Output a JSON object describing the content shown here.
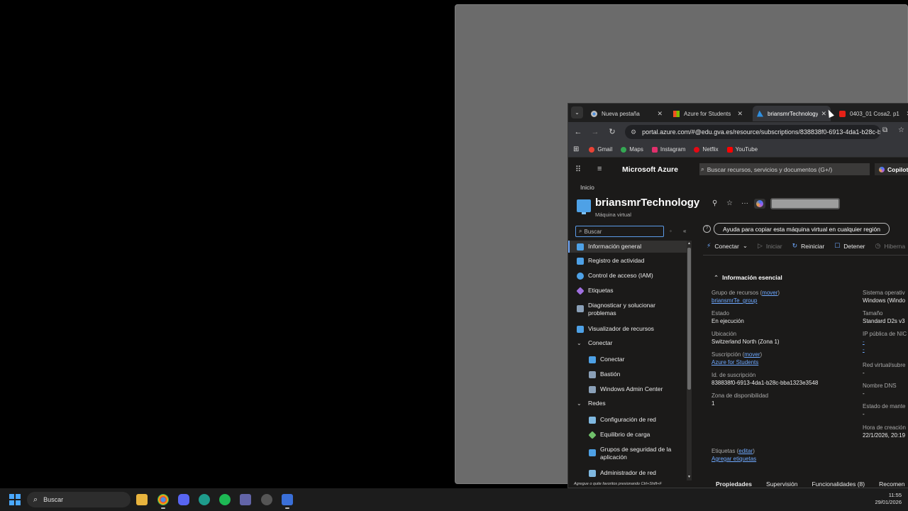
{
  "tabs": [
    {
      "title": "Nueva pestaña",
      "close": "✕",
      "icon": "chrome-icon"
    },
    {
      "title": "Azure for Students",
      "close": "✕",
      "icon": "microsoft-icon"
    },
    {
      "title": "briansmrTechnology",
      "close": "✕",
      "icon": "azure-icon",
      "active": true
    },
    {
      "title": "0403_01 Cosa2. p1",
      "close": "✕",
      "icon": "youtube-icon"
    }
  ],
  "toolbar": {
    "url": "portal.azure.com/#@edu.gva.es/resource/subscriptions/838838f0-6913-4da1-b28c-bba1323e3548/..."
  },
  "bookmarks": [
    {
      "label": "Gmail",
      "color": "#ea4335"
    },
    {
      "label": "Maps",
      "color": "#34a853"
    },
    {
      "label": "Instagram",
      "color": "#e1306c"
    },
    {
      "label": "Netflix",
      "color": "#e50914"
    },
    {
      "label": "YouTube",
      "color": "#ff0000"
    }
  ],
  "azure": {
    "brand": "Microsoft Azure",
    "search_placeholder": "Buscar recursos, servicios y documentos (G+/)",
    "copilot": "Copilot"
  },
  "breadcrumb": "Inicio",
  "resource": {
    "title": "briansmrTechnology",
    "subtitle": "Máquina virtual"
  },
  "menu": {
    "search_placeholder": "Buscar",
    "items": [
      {
        "label": "Información general",
        "level": 0,
        "icon": "monitor-icon",
        "color": "#4ea1e6",
        "selected": true
      },
      {
        "label": "Registro de actividad",
        "level": 0,
        "icon": "log-icon",
        "color": "#4ea1e6"
      },
      {
        "label": "Control de acceso (IAM)",
        "level": 0,
        "icon": "people-icon",
        "color": "#4ea1e6"
      },
      {
        "label": "Etiquetas",
        "level": 0,
        "icon": "tag-icon",
        "color": "#a070e0"
      },
      {
        "label": "Diagnosticar y solucionar problemas",
        "level": 0,
        "icon": "wrench-icon",
        "color": "#8aa0b8"
      },
      {
        "label": "Visualizador de recursos",
        "level": 0,
        "icon": "hierarchy-icon",
        "color": "#4ea1e6"
      },
      {
        "label": "Conectar",
        "level": 0,
        "chevron": true
      },
      {
        "label": "Conectar",
        "level": 1,
        "icon": "plug-icon",
        "color": "#4ea1e6"
      },
      {
        "label": "Bastión",
        "level": 1,
        "icon": "bastion-icon",
        "color": "#8aa0b8"
      },
      {
        "label": "Windows Admin Center",
        "level": 1,
        "icon": "admin-icon",
        "color": "#8aa0b8"
      },
      {
        "label": "Redes",
        "level": 0,
        "chevron": true
      },
      {
        "label": "Configuración de red",
        "level": 1,
        "icon": "network-icon",
        "color": "#7fb8e0"
      },
      {
        "label": "Equilibrio de carga",
        "level": 1,
        "icon": "loadbalancer-icon",
        "color": "#6fc06a"
      },
      {
        "label": "Grupos de seguridad de la aplicación",
        "level": 1,
        "icon": "shield-icon",
        "color": "#4ea1e6"
      },
      {
        "label": "Administrador de red",
        "level": 1,
        "icon": "netmanager-icon",
        "color": "#7fb8e0"
      }
    ],
    "favorites_hint": "Agregue o quite favoritos presionando Ctrl+Shift+F"
  },
  "help_button": "Ayuda para copiar esta máquina virtual en cualquier región",
  "commands": [
    {
      "label": "Conectar",
      "icon": "plug-icon",
      "disabled": false
    },
    {
      "label": "Iniciar",
      "icon": "play-icon",
      "disabled": true
    },
    {
      "label": "Reiniciar",
      "icon": "restart-icon",
      "disabled": false
    },
    {
      "label": "Detener",
      "icon": "stop-icon",
      "disabled": false
    },
    {
      "label": "Hiberna",
      "icon": "hibernate-icon",
      "disabled": true
    }
  ],
  "essentials": {
    "header": "Información esencial",
    "left": [
      {
        "label": "Grupo de recursos",
        "label_link": "mover",
        "value": "briansmrTe_group",
        "value_link": true
      },
      {
        "label": "Estado",
        "value": "En ejecución"
      },
      {
        "label": "Ubicación",
        "value": "Switzerland North (Zona 1)"
      },
      {
        "label": "Suscripción",
        "label_link": "mover",
        "value": "Azure for Students",
        "value_link": true
      },
      {
        "label": "Id. de suscripción",
        "value": "838838f0-6913-4da1-b28c-bba1323e3548"
      },
      {
        "label": "Zona de disponibilidad",
        "value": "1"
      }
    ],
    "right": [
      {
        "label": "Sistema operativ",
        "value": "Windows (Windo"
      },
      {
        "label": "Tamaño",
        "value": "Standard D2s v3"
      },
      {
        "label": "IP pública de NIC",
        "value": "-",
        "value2": "-"
      },
      {
        "label": "Red virtual/subre",
        "value": "-"
      },
      {
        "label": "Nombre DNS",
        "value": "-"
      },
      {
        "label": "Estado de mante",
        "value": "-"
      },
      {
        "label": "Hora de creación",
        "value": "22/1/2026, 20:19"
      }
    ],
    "tags_label": "Etiquetas",
    "tags_link": "editar",
    "tags_add": "Agregar etiquetas"
  },
  "bottom_tabs": [
    {
      "label": "Propiedades",
      "active": true
    },
    {
      "label": "Supervisión"
    },
    {
      "label": "Funcionalidades (8)"
    },
    {
      "label": "Recomen"
    }
  ],
  "taskbar": {
    "search": "Buscar",
    "time": "11:55",
    "date": "29/01/2026"
  }
}
